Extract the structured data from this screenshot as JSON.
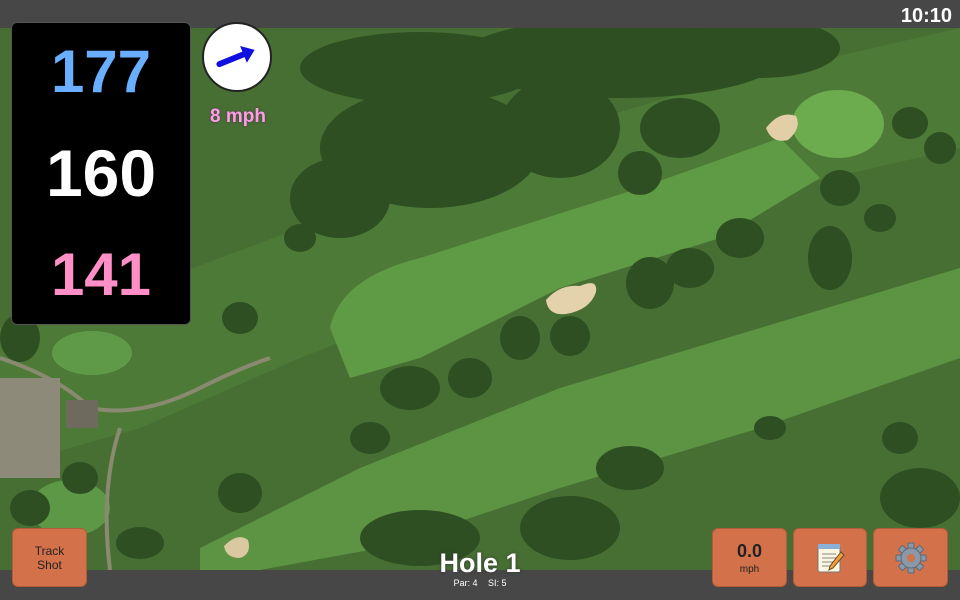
{
  "status": {
    "time": "10:10"
  },
  "distances": {
    "back": "177",
    "middle": "160",
    "front": "141"
  },
  "wind": {
    "speed_label": "8 mph",
    "arrow_icon": "wind-arrow-icon",
    "arrow_color": "#1010e0"
  },
  "buttons": {
    "track_shot_line1": "Track",
    "track_shot_line2": "Shot",
    "speed_value": "0.0",
    "speed_unit": "mph",
    "notes_icon": "notepad-icon",
    "settings_icon": "gear-icon"
  },
  "hole": {
    "title": "Hole 1",
    "par": "Par: 4",
    "si": "SI: 5"
  },
  "colors": {
    "button_bg": "#d2714a",
    "back_color": "#6aaeff",
    "front_color": "#ff8fc6",
    "wind_text": "#ff9ee6"
  }
}
